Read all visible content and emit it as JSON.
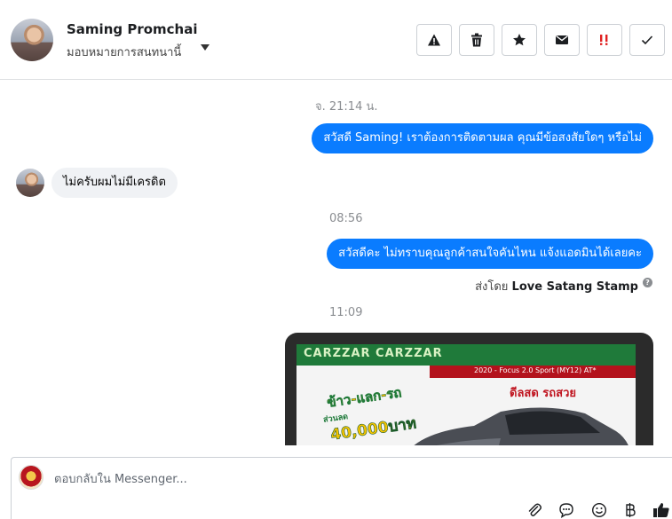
{
  "header": {
    "contact_name": "Saming Promchai",
    "assign_label": "มอบหมายการสนทนานี้",
    "actions": [
      {
        "name": "spam-icon"
      },
      {
        "name": "trash-icon"
      },
      {
        "name": "star-icon"
      },
      {
        "name": "envelope-icon"
      },
      {
        "name": "follow-up-icon"
      },
      {
        "name": "check-icon"
      }
    ]
  },
  "messages": {
    "timestamp_1": "จ. 21:14 น.",
    "outgoing_1": "สวัสดี Saming! เราต้องการติดตามผล คุณมีข้อสงสัยใดๆ หรือไม่",
    "incoming_1": "ไม่ครับผมไม่มีเครดิต",
    "timestamp_2": "08:56",
    "outgoing_2": "สวัสดีคะ ไม่ทราบคุณลูกค้าสนใจคันไหน แจ้งแอดมินได้เลยคะ",
    "sent_by_prefix": "ส่งโดย",
    "sent_by_name": "Love Satang Stamp",
    "timestamp_3": "11:09",
    "image": {
      "banner_text": "CARZZAR CARZZAR",
      "model_text": "2020 - Focus 2.0 Sport (MY12) AT*",
      "promo_line_1": "ข้าว-แลก-รถ",
      "promo_line_2": "ส่วนลด",
      "promo_line_3": "40,000บาท",
      "deal_text": "ดีลสด รถสวย"
    }
  },
  "composer": {
    "placeholder": "ตอบกลับใน Messenger...",
    "tools": [
      "paperclip-icon",
      "chat-bubble-icon",
      "emoji-icon",
      "baht-icon",
      "thumbs-up-icon"
    ]
  },
  "colors": {
    "accent": "#0a7cff",
    "incoming_bubble": "#f0f2f5",
    "follow_up_red": "#e02020"
  }
}
